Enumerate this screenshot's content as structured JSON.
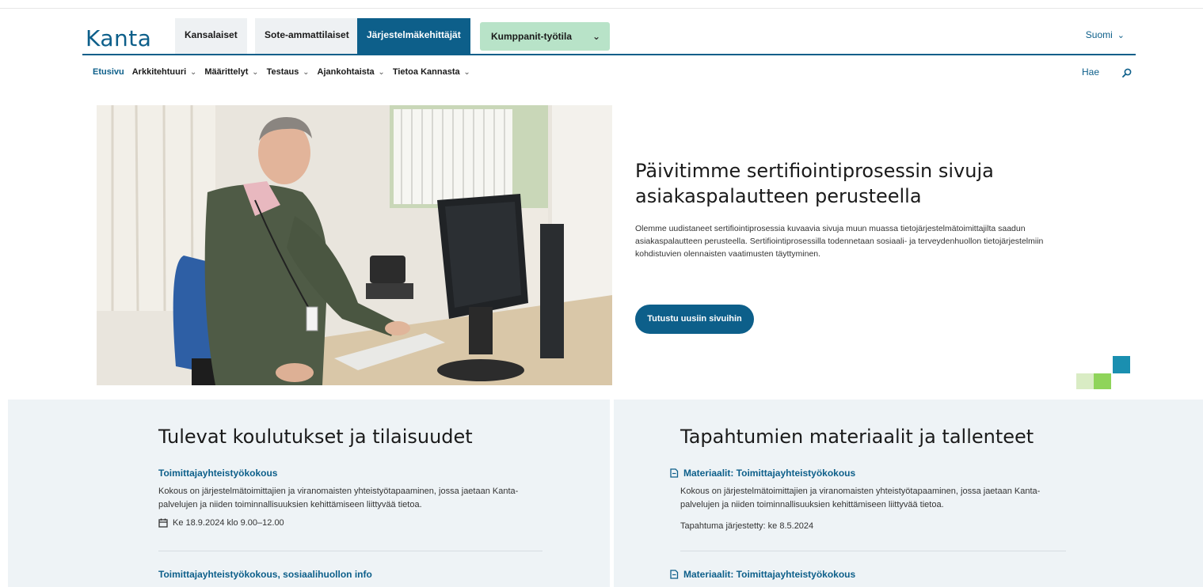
{
  "header": {
    "logo": "Kanta",
    "tabs": [
      {
        "label": "Kansalaiset",
        "active": false
      },
      {
        "label": "Sote-ammattilaiset",
        "active": false
      },
      {
        "label": "Järjestelmäkehittäjät",
        "active": true
      }
    ],
    "partner_select": "Kumppanit-työtila",
    "language": "Suomi"
  },
  "subnav": {
    "items": [
      {
        "label": "Etusivu",
        "current": true,
        "dropdown": false
      },
      {
        "label": "Arkkitehtuuri",
        "current": false,
        "dropdown": true
      },
      {
        "label": "Määrittelyt",
        "current": false,
        "dropdown": true
      },
      {
        "label": "Testaus",
        "current": false,
        "dropdown": true
      },
      {
        "label": "Ajankohtaista",
        "current": false,
        "dropdown": true
      },
      {
        "label": "Tietoa Kannasta",
        "current": false,
        "dropdown": true
      }
    ],
    "search_label": "Hae"
  },
  "hero": {
    "title": "Päivitimme sertifiointiprosessin sivuja asiakaspalautteen perusteella",
    "text": "Olemme uudistaneet sertifiointiprosessia kuvaavia sivuja muun muassa tietojärjestelmätoimittajilta saadun asiakaspalautteen perusteella. Sertifiointiprosessilla todennetaan sosiaali- ja terveydenhuollon tietojärjestelmiin kohdistuvien olennaisten vaatimusten täyttyminen.",
    "button": "Tutustu uusiin sivuihin"
  },
  "events": {
    "title": "Tulevat koulutukset ja tilaisuudet",
    "items": [
      {
        "title": "Toimittajayhteistyökokous",
        "description": "Kokous on järjestelmätoimittajien ja viranomaisten yhteistyötapaaminen, jossa jaetaan Kanta-palvelujen ja niiden toiminnallisuuksien kehittämiseen liittyvää tietoa.",
        "date": "Ke 18.9.2024 klo 9.00–12.00"
      },
      {
        "title": "Toimittajayhteistyökokous, sosiaalihuollon info"
      }
    ]
  },
  "materials": {
    "title": "Tapahtumien materiaalit ja tallenteet",
    "items": [
      {
        "title": "Materiaalit: Toimittajayhteistyökokous",
        "description": "Kokous on järjestelmätoimittajien ja viranomaisten yhteistyötapaaminen, jossa jaetaan Kanta-palvelujen ja niiden toiminnallisuuksien kehittämiseen liittyvää tietoa.",
        "meta": "Tapahtuma järjestetty: ke 8.5.2024"
      },
      {
        "title": "Materiaalit: Toimittajayhteistyökokous"
      }
    ]
  },
  "colors": {
    "brand_blue": "#0d5f8a",
    "partner_green": "#b8e3c8",
    "panel_bg": "#eef3f6",
    "deco_teal": "#1a8fb0",
    "deco_green": "#8fd45a",
    "deco_light": "#d9ecc4"
  }
}
